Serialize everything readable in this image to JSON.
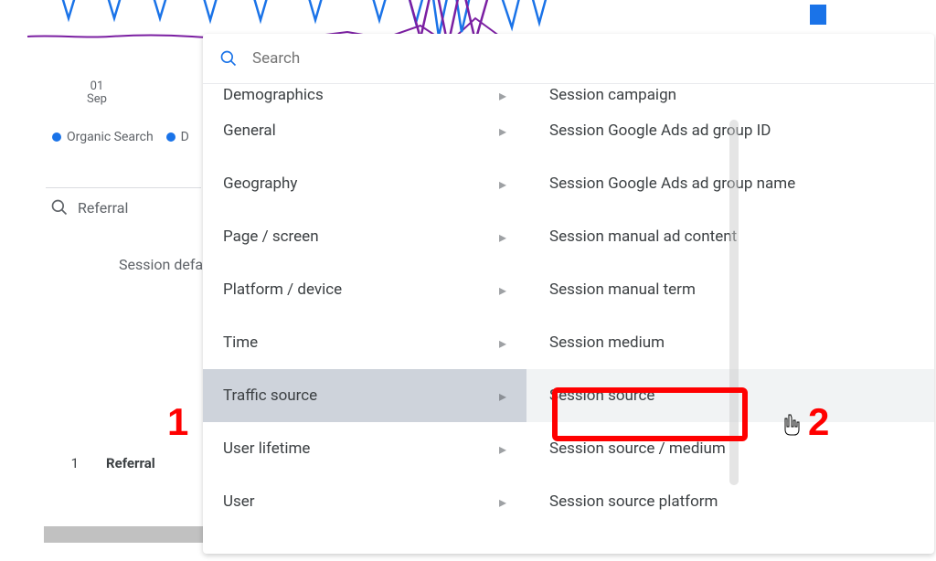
{
  "date_label": "01\nSep",
  "legend": [
    {
      "label": "Organic Search",
      "color": "#1a73e8"
    },
    {
      "label": "D",
      "color": "#1a73e8"
    }
  ],
  "bg_search_value": "Referral",
  "session_def": "Session defa",
  "annotation1": "1",
  "annotation2": "2",
  "table": {
    "index": "1",
    "name": "Referral"
  },
  "panel": {
    "search_placeholder": "Search",
    "categories_cutoff_top": "Demographics",
    "categories": [
      "General",
      "Geography",
      "Page / screen",
      "Platform / device",
      "Time",
      "Traffic source",
      "User lifetime",
      "User"
    ],
    "selected_category_index": 5,
    "options_cutoff_top": "Session campaign",
    "options": [
      "Session Google Ads ad group ID",
      "Session Google Ads ad group name",
      "Session manual ad content",
      "Session manual term",
      "Session medium",
      "Session source",
      "Session source / medium",
      "Session source platform"
    ],
    "highlighted_option_index": 5
  }
}
